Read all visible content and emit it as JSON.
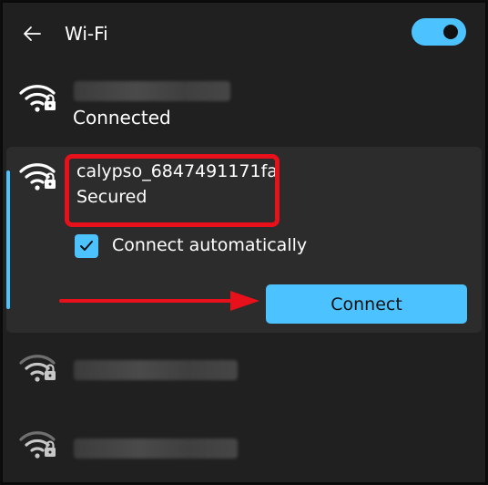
{
  "header": {
    "title": "Wi-Fi",
    "back_icon": "arrow-left-icon",
    "wifi_enabled": true
  },
  "networks": {
    "connected": {
      "status": "Connected"
    },
    "selected": {
      "ssid": "calypso_6847491171fa",
      "security": "Secured",
      "connect_automatically_label": "Connect automatically",
      "connect_automatically_checked": true,
      "connect_button_label": "Connect"
    }
  },
  "colors": {
    "accent": "#4cc2ff",
    "panel_bg": "#202020",
    "card_bg": "#2c2c2c",
    "annotation_red": "#e8101b"
  },
  "icons": {
    "network": "wifi-secured-icon",
    "check": "checkmark-icon",
    "annotation": "red-arrow-annotation"
  }
}
